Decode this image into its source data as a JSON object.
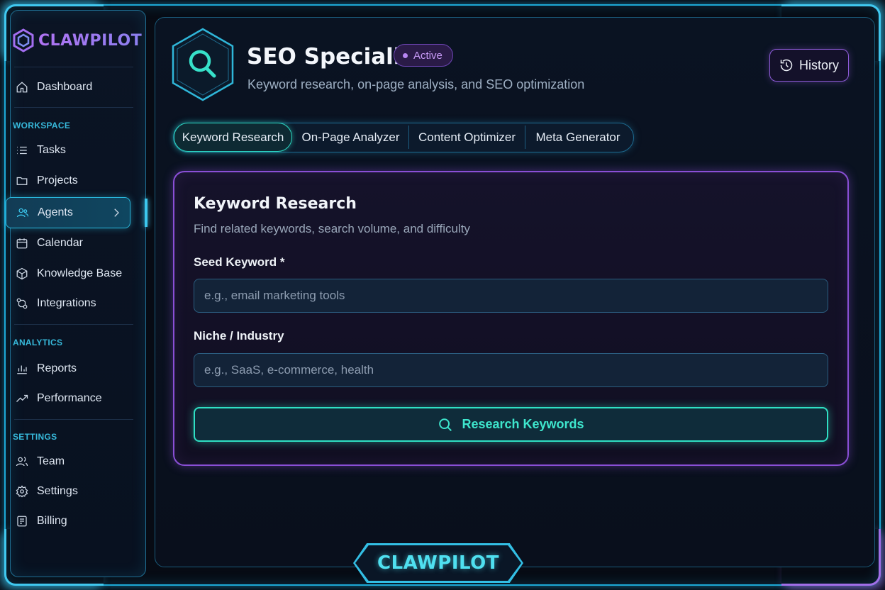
{
  "brand": {
    "name": "CLAWPILOT",
    "logo_icon": "hexagon-logo-icon"
  },
  "sidebar": {
    "top_items": [
      {
        "label": "Dashboard",
        "icon": "home-icon"
      }
    ],
    "sections": [
      {
        "title": "WORKSPACE",
        "items": [
          {
            "label": "Tasks",
            "icon": "list-icon"
          },
          {
            "label": "Projects",
            "icon": "folder-icon"
          },
          {
            "label": "Agents",
            "icon": "users-icon",
            "active": true
          },
          {
            "label": "Calendar",
            "icon": "calendar-icon"
          },
          {
            "label": "Knowledge Base",
            "icon": "box-icon"
          },
          {
            "label": "Integrations",
            "icon": "integrations-icon"
          }
        ]
      },
      {
        "title": "ANALYTICS",
        "items": [
          {
            "label": "Reports",
            "icon": "bar-chart-icon"
          },
          {
            "label": "Performance",
            "icon": "trend-icon"
          }
        ]
      },
      {
        "title": "SETTINGS",
        "items": [
          {
            "label": "Team",
            "icon": "team-icon"
          },
          {
            "label": "Settings",
            "icon": "gear-icon"
          },
          {
            "label": "Billing",
            "icon": "billing-icon"
          }
        ]
      }
    ]
  },
  "header": {
    "title": "SEO Specialist",
    "status_badge": "Active",
    "subtitle": "Keyword research, on-page analysis, and SEO optimization",
    "history_label": "History"
  },
  "tabs": [
    {
      "label": "Keyword Research",
      "active": true
    },
    {
      "label": "On-Page Analyzer"
    },
    {
      "label": "Content Optimizer"
    },
    {
      "label": "Meta Generator"
    }
  ],
  "form": {
    "title": "Keyword Research",
    "description": "Find related keywords, search volume, and difficulty",
    "seed_keyword": {
      "label": "Seed Keyword *",
      "placeholder": "e.g., email marketing tools",
      "value": ""
    },
    "niche": {
      "label": "Niche / Industry",
      "placeholder": "e.g., SaaS, e-commerce, health",
      "value": ""
    },
    "submit_label": "Research Keywords"
  },
  "footer_brand": "CLAWPILOT",
  "colors": {
    "accent_cyan": "#2fe0c4",
    "accent_purple": "#8a4fd6",
    "frame_blue": "#1da9d6"
  }
}
